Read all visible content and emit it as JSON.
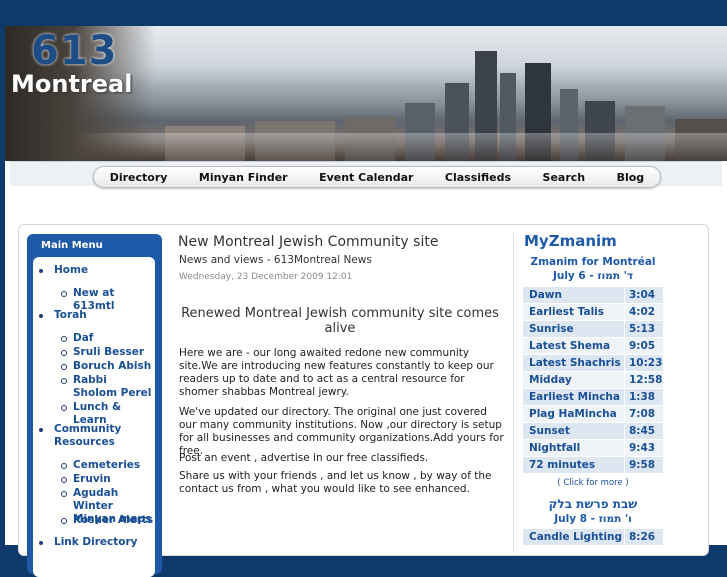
{
  "logo": {
    "number": "613",
    "city": "Montreal"
  },
  "nav": [
    "Directory",
    "Minyan Finder",
    "Event Calendar",
    "Classifieds",
    "Search",
    "Blog"
  ],
  "main_menu": {
    "title": "Main Menu",
    "items": [
      {
        "label": "Home",
        "children": [
          "New at 613mtl"
        ]
      },
      {
        "label": "Torah",
        "children": [
          "Daf",
          "Sruli Besser",
          "Boruch Abish",
          "Rabbi Sholom Perel",
          "Lunch & Learn"
        ]
      },
      {
        "label": "Community Resources",
        "children": [
          "Cemeteries",
          "Eruvin",
          "Agudah Winter Minyan maps",
          "Kosher Alerts"
        ]
      },
      {
        "label": "Link Directory",
        "children": []
      }
    ]
  },
  "article": {
    "title": "New Montreal Jewish Community site",
    "subtitle": "News and views - 613Montreal News",
    "date": "Wednesday, 23 December 2009 12:01",
    "heading": "Renewed Montreal Jewish community site comes alive",
    "paragraphs": [
      "Here we are - our long awaited redone new community site.We are introducing new features constantly to keep our readers up to date and to act as a central resource for shomer shabbas Montreal  jewry.",
      "We've updated our directory. The original one just covered our many community institutions. Now ,our directory is setup for all businesses and community organizations.Add yours for free.",
      "Post an event , advertise in our free classifieds.",
      "Share us with your friends , and let us know , by way of the contact us from , what you would like to see enhanced."
    ]
  },
  "zmanim": {
    "title": "MyZmanim",
    "subtitle": "Zmanim for Montréal",
    "date": "July 6 - ד' תמוז",
    "times": [
      {
        "name": "Dawn",
        "time": "3:04"
      },
      {
        "name": "Earliest Talis",
        "time": "4:02"
      },
      {
        "name": "Sunrise",
        "time": "5:13"
      },
      {
        "name": "Latest Shema",
        "time": "9:05"
      },
      {
        "name": "Latest Shachris",
        "time": "10:23"
      },
      {
        "name": "Midday",
        "time": "12:58"
      },
      {
        "name": "Earliest Mincha",
        "time": "1:38"
      },
      {
        "name": "Plag HaMincha",
        "time": "7:08"
      },
      {
        "name": "Sunset",
        "time": "8:45"
      },
      {
        "name": "Nightfall",
        "time": "9:43"
      },
      {
        "name": "72 minutes",
        "time": "9:58"
      }
    ],
    "click_more": "( Click for more )",
    "shabbos_title": "שבת פרשת בלק",
    "shabbos_date": "July 8 - ו' תמוז",
    "shabbos_times": [
      {
        "name": "Candle Lighting",
        "time": "8:26"
      }
    ]
  },
  "colors": {
    "page_bg": "#0e3a6b",
    "accent": "#1e5aa8",
    "link": "#1a4f95"
  }
}
